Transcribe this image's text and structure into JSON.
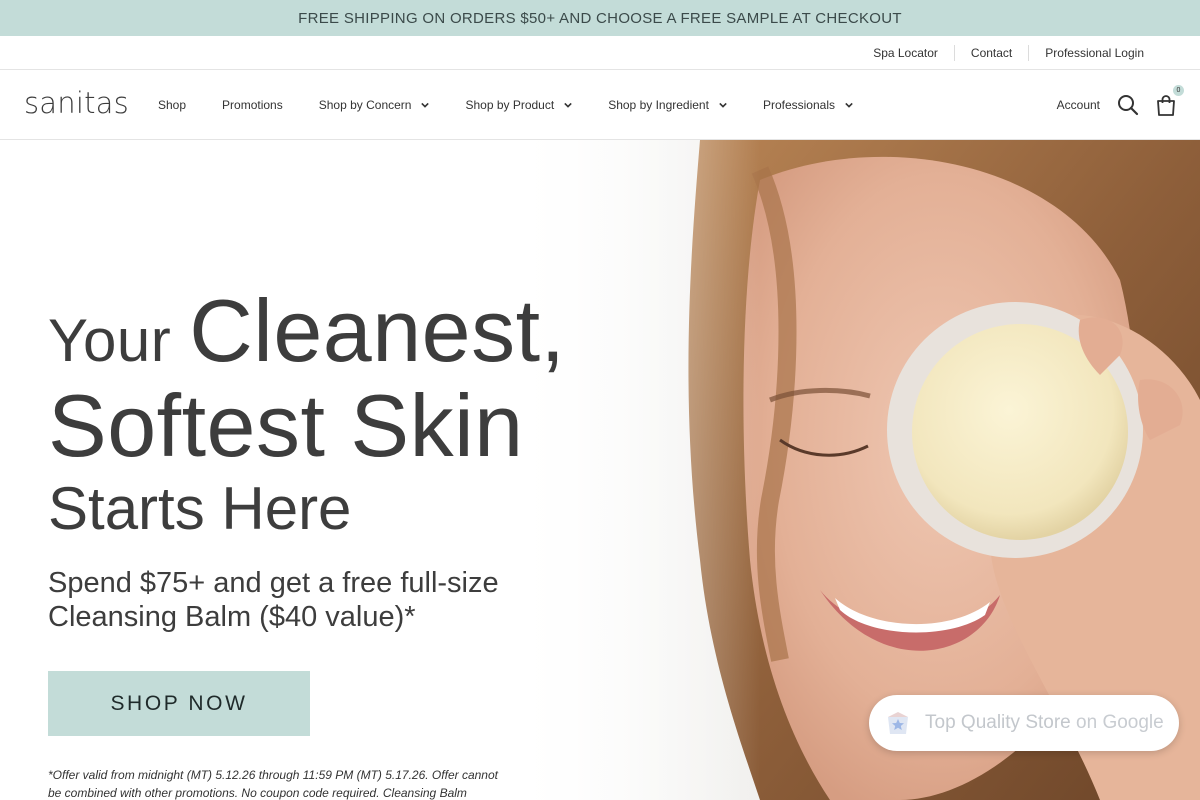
{
  "promo_bar": {
    "text": "FREE SHIPPING ON ORDERS $50+ AND CHOOSE A FREE SAMPLE AT CHECKOUT"
  },
  "utility_links": [
    "Spa Locator",
    "Contact",
    "Professional Login"
  ],
  "logo": "sanitas",
  "nav": {
    "items": [
      {
        "label": "Shop",
        "dropdown": false
      },
      {
        "label": "Promotions",
        "dropdown": false
      },
      {
        "label": "Shop by Concern",
        "dropdown": true
      },
      {
        "label": "Shop by Product",
        "dropdown": true
      },
      {
        "label": "Shop by Ingredient",
        "dropdown": true
      },
      {
        "label": "Professionals",
        "dropdown": true
      }
    ],
    "account_label": "Account",
    "cart_count": "0"
  },
  "hero": {
    "headline_small_1": "Your",
    "headline_big_1": "Cleanest,",
    "headline_big_2": "Softest Skin",
    "headline_small_2": "Starts Here",
    "subhead": "Spend $75+ and get a free full-size Cleansing Balm ($40 value)*",
    "cta_label": "SHOP NOW",
    "disclaimer": "*Offer valid from midnight (MT) 5.12.26 through 11:59 PM (MT) 5.17.26. Offer cannot be combined with other promotions. No coupon code required. Cleansing Balm"
  },
  "google_badge": {
    "text_main": "Top Quality Store",
    "text_suffix": "on Google"
  },
  "colors": {
    "accent": "#c3dcd8",
    "text": "#3d3d3d"
  },
  "icons": [
    "chevron-down-icon",
    "search-icon",
    "shopping-bag-icon",
    "google-shopping-icon"
  ]
}
